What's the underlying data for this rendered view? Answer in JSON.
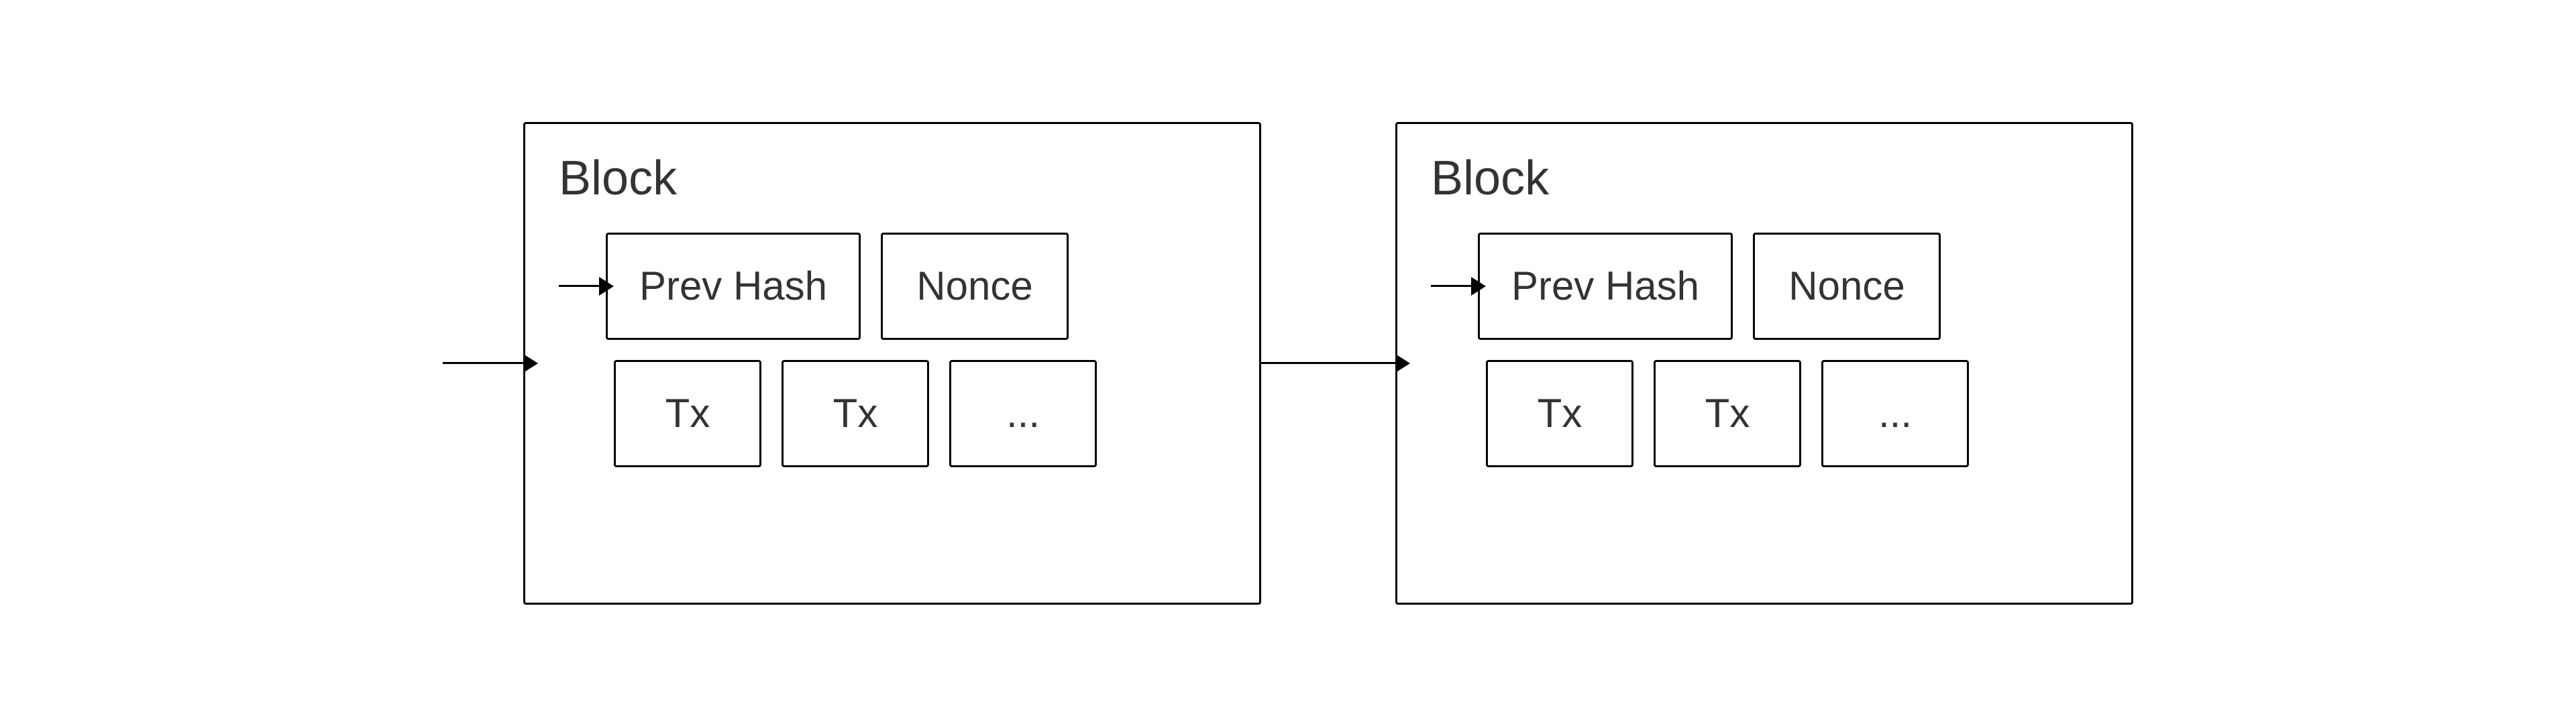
{
  "diagram": {
    "blocks": [
      {
        "id": "block-1",
        "label": "Block",
        "prev_hash_label": "Prev Hash",
        "nonce_label": "Nonce",
        "tx1_label": "Tx",
        "tx2_label": "Tx",
        "tx3_label": "..."
      },
      {
        "id": "block-2",
        "label": "Block",
        "prev_hash_label": "Prev Hash",
        "nonce_label": "Nonce",
        "tx1_label": "Tx",
        "tx2_label": "Tx",
        "tx3_label": "..."
      }
    ]
  }
}
